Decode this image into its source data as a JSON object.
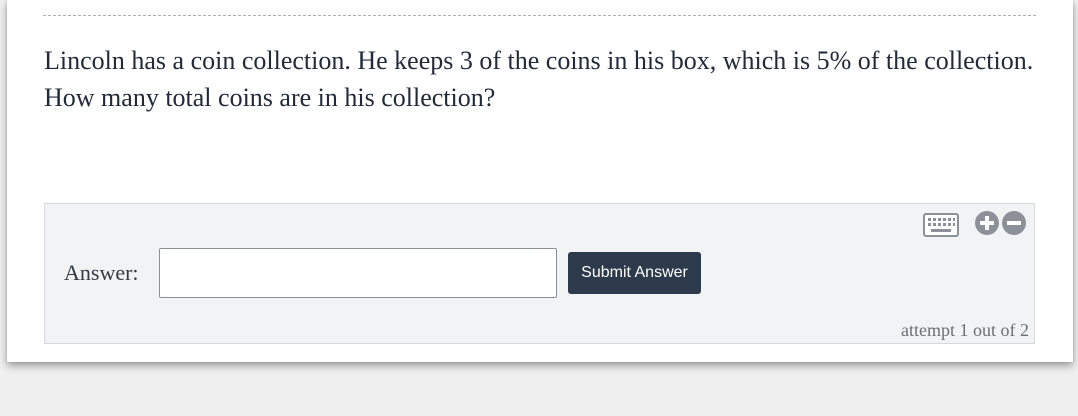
{
  "question": {
    "text": "Lincoln has a coin collection. He keeps 3 of the coins in his box, which is 5% of the collection. How many total coins are in his collection?"
  },
  "answer": {
    "label": "Answer:",
    "value": "",
    "placeholder": "",
    "submit_label": "Submit Answer",
    "attempt_text": "attempt 1 out of 2"
  },
  "icons": {
    "keyboard": "keyboard-icon",
    "zoom_in": "plus-circle-icon",
    "zoom_out": "minus-circle-icon"
  },
  "colors": {
    "question_text": "#222a3a",
    "button_bg": "#2c3a4b",
    "panel_bg": "#f2f3f5",
    "icon_gray": "#8c9199"
  }
}
